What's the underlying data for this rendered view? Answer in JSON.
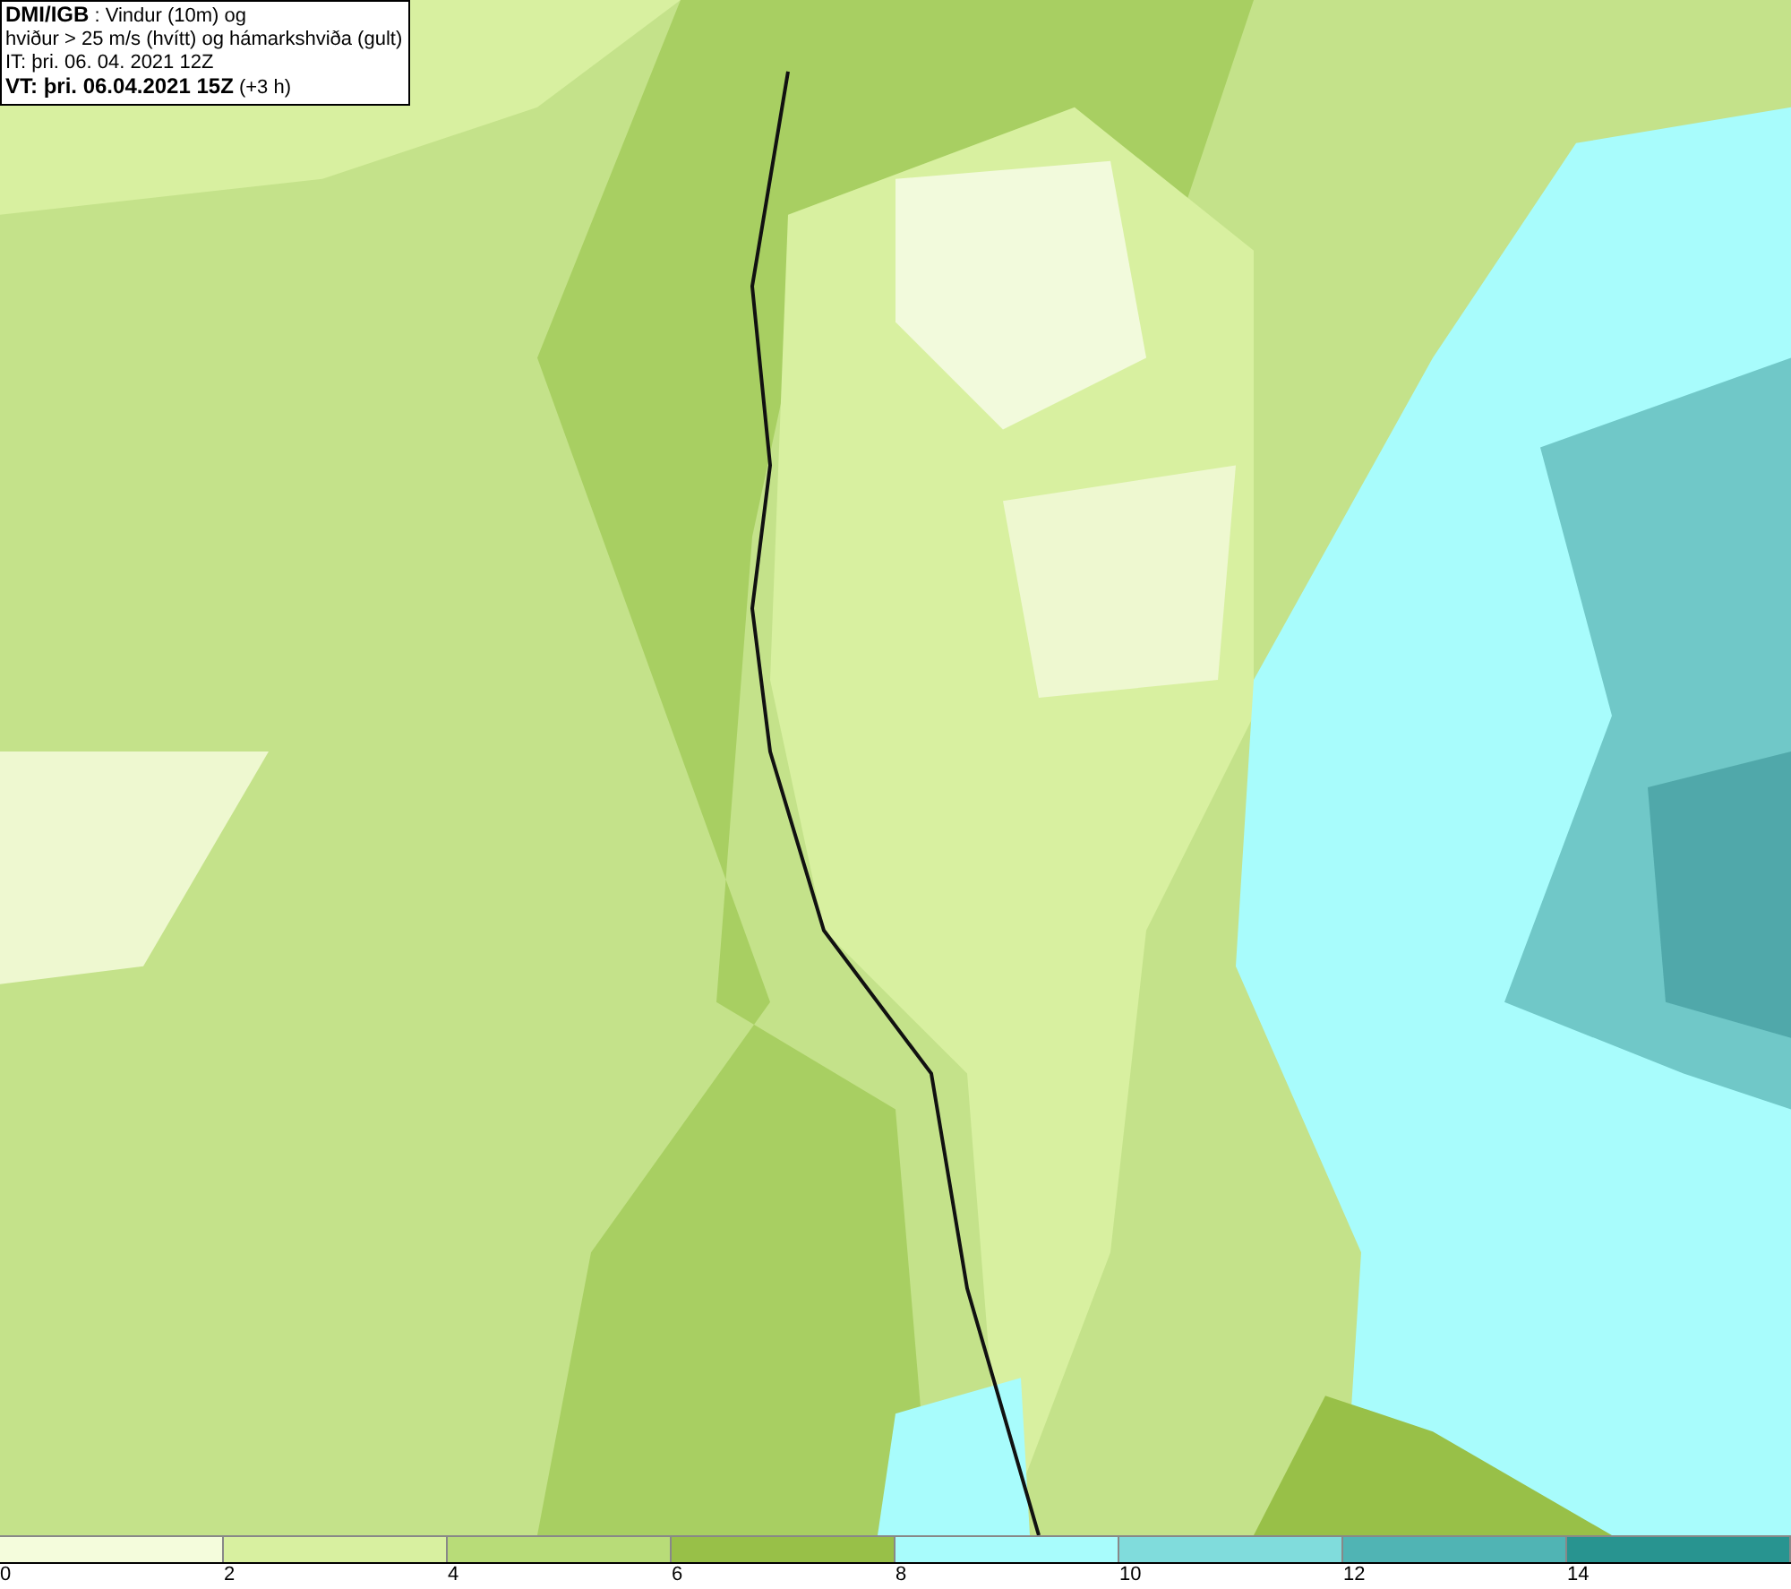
{
  "header": {
    "lines": [
      "**DMI/IGB** : Vindur (10m) og",
      "hviður > 25 m/s (hvítt) og hámarkshviða (gult)",
      "IT: þri. 06. 04. 2021 12Z",
      "**VT: þri. 06.04.2021 15Z** (+3 h)"
    ]
  },
  "legend": {
    "items": [
      {
        "color": "#f4fcdc",
        "label": "0"
      },
      {
        "color": "#d8f0a0",
        "label": "2"
      },
      {
        "color": "#b8dc78",
        "label": "4"
      },
      {
        "color": "#98c048",
        "label": "6"
      },
      {
        "color": "#a8fcfc",
        "label": "8"
      },
      {
        "color": "#80dcdc",
        "label": "10"
      },
      {
        "color": "#50b4b4",
        "label": "12"
      },
      {
        "color": "#289490",
        "label": "14"
      }
    ]
  }
}
